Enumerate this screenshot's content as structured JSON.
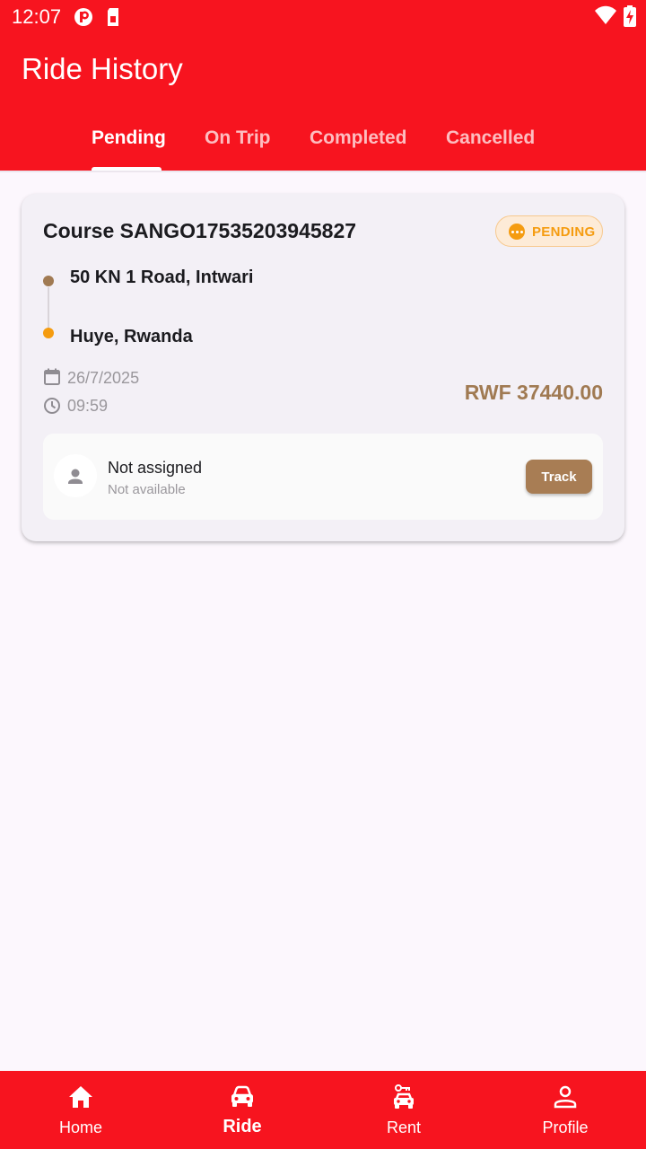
{
  "status_bar": {
    "time": "12:07"
  },
  "header": {
    "title": "Ride History"
  },
  "tabs": [
    {
      "label": "Pending",
      "active": true
    },
    {
      "label": "On Trip",
      "active": false
    },
    {
      "label": "Completed",
      "active": false
    },
    {
      "label": "Cancelled",
      "active": false
    }
  ],
  "ride": {
    "course": "Course SANGO17535203945827",
    "status": "PENDING",
    "pickup": "50 KN 1 Road, Intwari",
    "dropoff": "Huye, Rwanda",
    "date": "26/7/2025",
    "time": "09:59",
    "fare": "RWF 37440.00",
    "driver": {
      "name": "Not assigned",
      "subtitle": "Not available"
    },
    "track_label": "Track"
  },
  "bottom_nav": [
    {
      "label": "Home",
      "icon": "home-icon",
      "active": false
    },
    {
      "label": "Ride",
      "icon": "car-icon",
      "active": true
    },
    {
      "label": "Rent",
      "icon": "car-key-icon",
      "active": false
    },
    {
      "label": "Profile",
      "icon": "person-icon",
      "active": false
    }
  ],
  "colors": {
    "primary": "#f7141f",
    "accent_brown": "#a87d54",
    "pending_orange": "#f59c10",
    "background": "#fcf7fd"
  }
}
